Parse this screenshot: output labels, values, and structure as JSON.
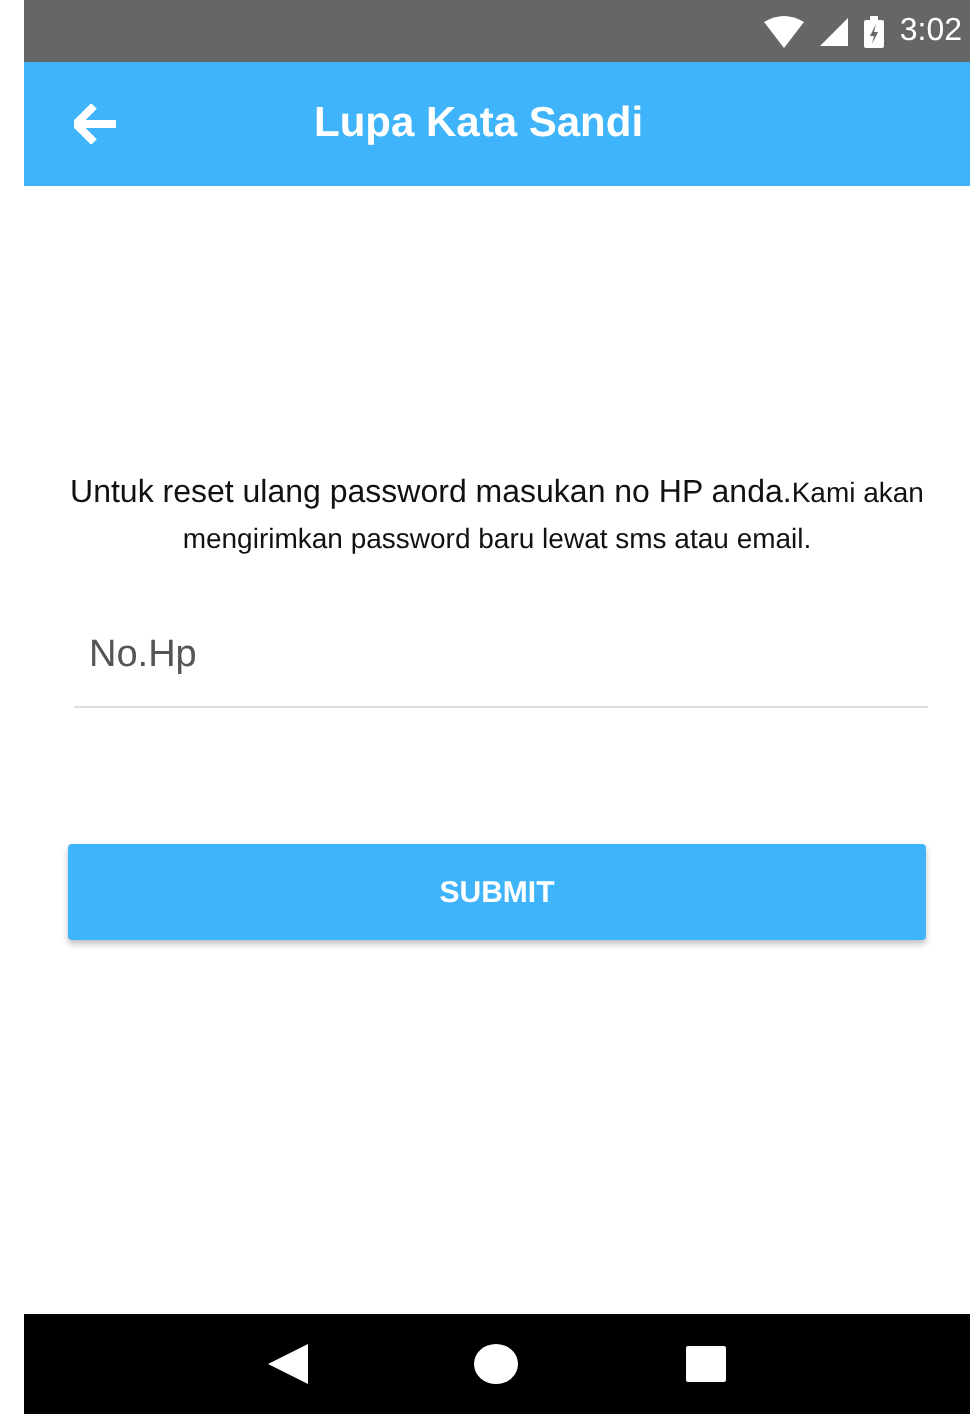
{
  "status_bar": {
    "time": "3:02"
  },
  "app_bar": {
    "title": "Lupa Kata Sandi"
  },
  "message": {
    "lead": "Untuk reset ulang password masukan no HP anda.",
    "rest": "Kami akan mengirimkan password baru lewat sms atau email."
  },
  "phone_field": {
    "placeholder": "No.Hp"
  },
  "submit_button": {
    "label": "SUBMIT"
  }
}
